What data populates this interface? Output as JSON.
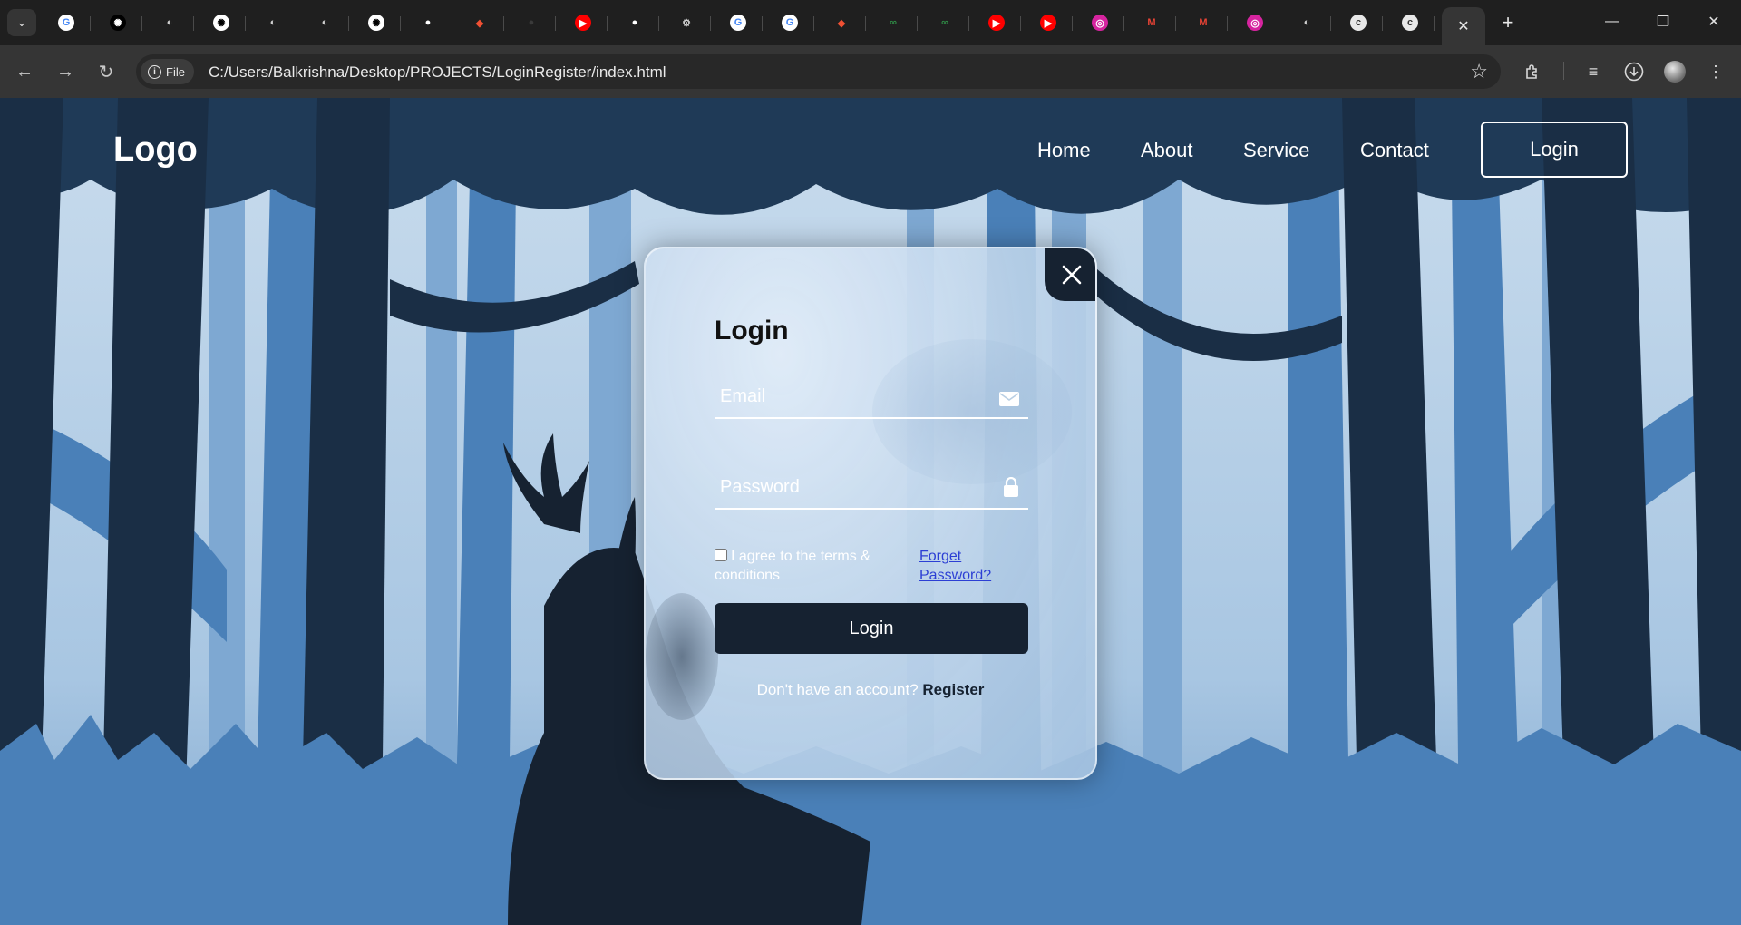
{
  "browser": {
    "tabs": [
      {
        "icon": "google-icon",
        "glyph": "G",
        "color": "#4285f4",
        "bg": "#ffffff"
      },
      {
        "icon": "chatgpt-icon",
        "glyph": "✺",
        "color": "#ffffff",
        "bg": "#000000"
      },
      {
        "icon": "globe-icon",
        "glyph": "◐",
        "color": "#cfcfcf",
        "bg": "transparent"
      },
      {
        "icon": "chatgpt-icon",
        "glyph": "✺",
        "color": "#000000",
        "bg": "#ffffff"
      },
      {
        "icon": "globe-icon",
        "glyph": "◐",
        "color": "#cfcfcf",
        "bg": "transparent"
      },
      {
        "icon": "globe-icon",
        "glyph": "◐",
        "color": "#cfcfcf",
        "bg": "transparent"
      },
      {
        "icon": "chatgpt-icon",
        "glyph": "✺",
        "color": "#000000",
        "bg": "#ffffff"
      },
      {
        "icon": "github-icon",
        "glyph": "●",
        "color": "#ffffff",
        "bg": "transparent"
      },
      {
        "icon": "git-icon",
        "glyph": "◆",
        "color": "#f05033",
        "bg": "transparent"
      },
      {
        "icon": "github-icon",
        "glyph": "●",
        "color": "#3a3a3a",
        "bg": "transparent"
      },
      {
        "icon": "youtube-icon",
        "glyph": "▶",
        "color": "#ffffff",
        "bg": "#ff0000"
      },
      {
        "icon": "github-icon",
        "glyph": "●",
        "color": "#ffffff",
        "bg": "transparent"
      },
      {
        "icon": "settings-icon",
        "glyph": "⚙",
        "color": "#d0d0d0",
        "bg": "transparent"
      },
      {
        "icon": "google-icon",
        "glyph": "G",
        "color": "#4285f4",
        "bg": "#ffffff"
      },
      {
        "icon": "google-lens-icon",
        "glyph": "G",
        "color": "#4285f4",
        "bg": "#ffffff"
      },
      {
        "icon": "git-icon",
        "glyph": "◆",
        "color": "#f05033",
        "bg": "transparent"
      },
      {
        "icon": "geeksforgeeks-icon",
        "glyph": "∞",
        "color": "#2f8d46",
        "bg": "transparent"
      },
      {
        "icon": "geeksforgeeks-icon",
        "glyph": "∞",
        "color": "#2f8d46",
        "bg": "transparent"
      },
      {
        "icon": "youtube-icon",
        "glyph": "▶",
        "color": "#ffffff",
        "bg": "#ff0000"
      },
      {
        "icon": "youtube-icon",
        "glyph": "▶",
        "color": "#ffffff",
        "bg": "#ff0000"
      },
      {
        "icon": "instagram-icon",
        "glyph": "◎",
        "color": "#ffffff",
        "bg": "#d6249f"
      },
      {
        "icon": "gmail-icon",
        "glyph": "M",
        "color": "#ea4335",
        "bg": "transparent"
      },
      {
        "icon": "gmail-icon",
        "glyph": "M",
        "color": "#ea4335",
        "bg": "transparent"
      },
      {
        "icon": "instagram-icon",
        "glyph": "◎",
        "color": "#ffffff",
        "bg": "#d6249f"
      },
      {
        "icon": "globe-icon",
        "glyph": "◐",
        "color": "#cfcfcf",
        "bg": "transparent"
      },
      {
        "icon": "c-letter-icon",
        "glyph": "c",
        "color": "#333333",
        "bg": "#e8e8e8"
      },
      {
        "icon": "c-letter-icon",
        "glyph": "c",
        "color": "#333333",
        "bg": "#e8e8e8"
      }
    ],
    "active_tab_close": "✕",
    "new_tab": "+",
    "window_controls": [
      "—",
      "❐",
      "✕"
    ],
    "site_info_label": "File",
    "url": "C:/Users/Balkrishna/Desktop/PROJECTS/LoginRegister/index.html"
  },
  "header": {
    "logo": "Logo",
    "nav": [
      "Home",
      "About",
      "Service",
      "Contact"
    ],
    "login_button": "Login"
  },
  "form": {
    "title": "Login",
    "email_placeholder": "Email",
    "password_placeholder": "Password",
    "terms": "I agree to the terms & conditions",
    "forget": "Forget Password?",
    "submit": "Login",
    "no_account": "Don't have an account?",
    "register": "Register"
  },
  "colors": {
    "accent_dark": "#162231",
    "link": "#2c3fd4"
  }
}
